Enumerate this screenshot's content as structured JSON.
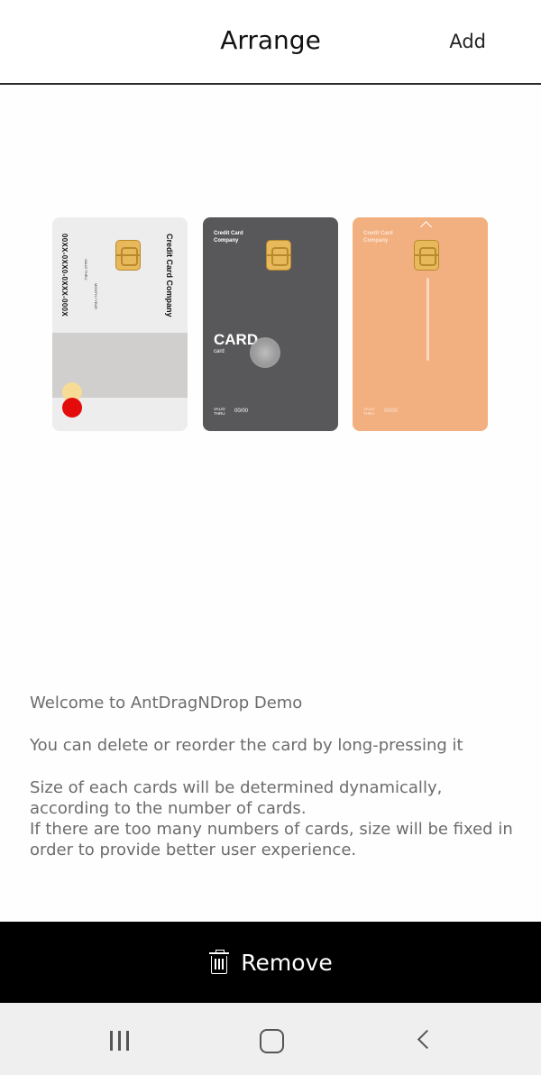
{
  "header": {
    "title": "Arrange",
    "add_label": "Add"
  },
  "cards": [
    {
      "style": "white",
      "company": "Credit Card Company",
      "number": "00XX-0XX0-0XXX-000X",
      "valid_label": "VALID THRU",
      "month_year": "MONTH / YEAR",
      "colors": {
        "background": "#ededed",
        "band": "#d0cfcd",
        "circle_yellow": "#f6dc97",
        "circle_red": "#e40b0b"
      }
    },
    {
      "style": "dark",
      "company": "Credit Card Company",
      "big_text": "CARD",
      "small_text": "card",
      "valid_label": "VALID THRU",
      "expiry": "00/00",
      "colors": {
        "background": "#58585a"
      }
    },
    {
      "style": "orange",
      "company": "Credit Card Company",
      "valid_label": "VALID THRU",
      "expiry": "00/00",
      "colors": {
        "background": "#f2af80"
      }
    }
  ],
  "info": {
    "line1": "Welcome to AntDragNDrop Demo",
    "line2": "You can delete or reorder the card by long-pressing it",
    "line3": "Size of each cards will be determined dynamically, according to the number of cards.\nIf there are too many numbers of cards, size will be fixed in order to provide better user experience."
  },
  "remove_bar": {
    "label": "Remove",
    "icon": "trash-icon"
  },
  "navbar": {
    "icons": [
      "recent-apps-icon",
      "home-icon",
      "back-icon"
    ]
  }
}
